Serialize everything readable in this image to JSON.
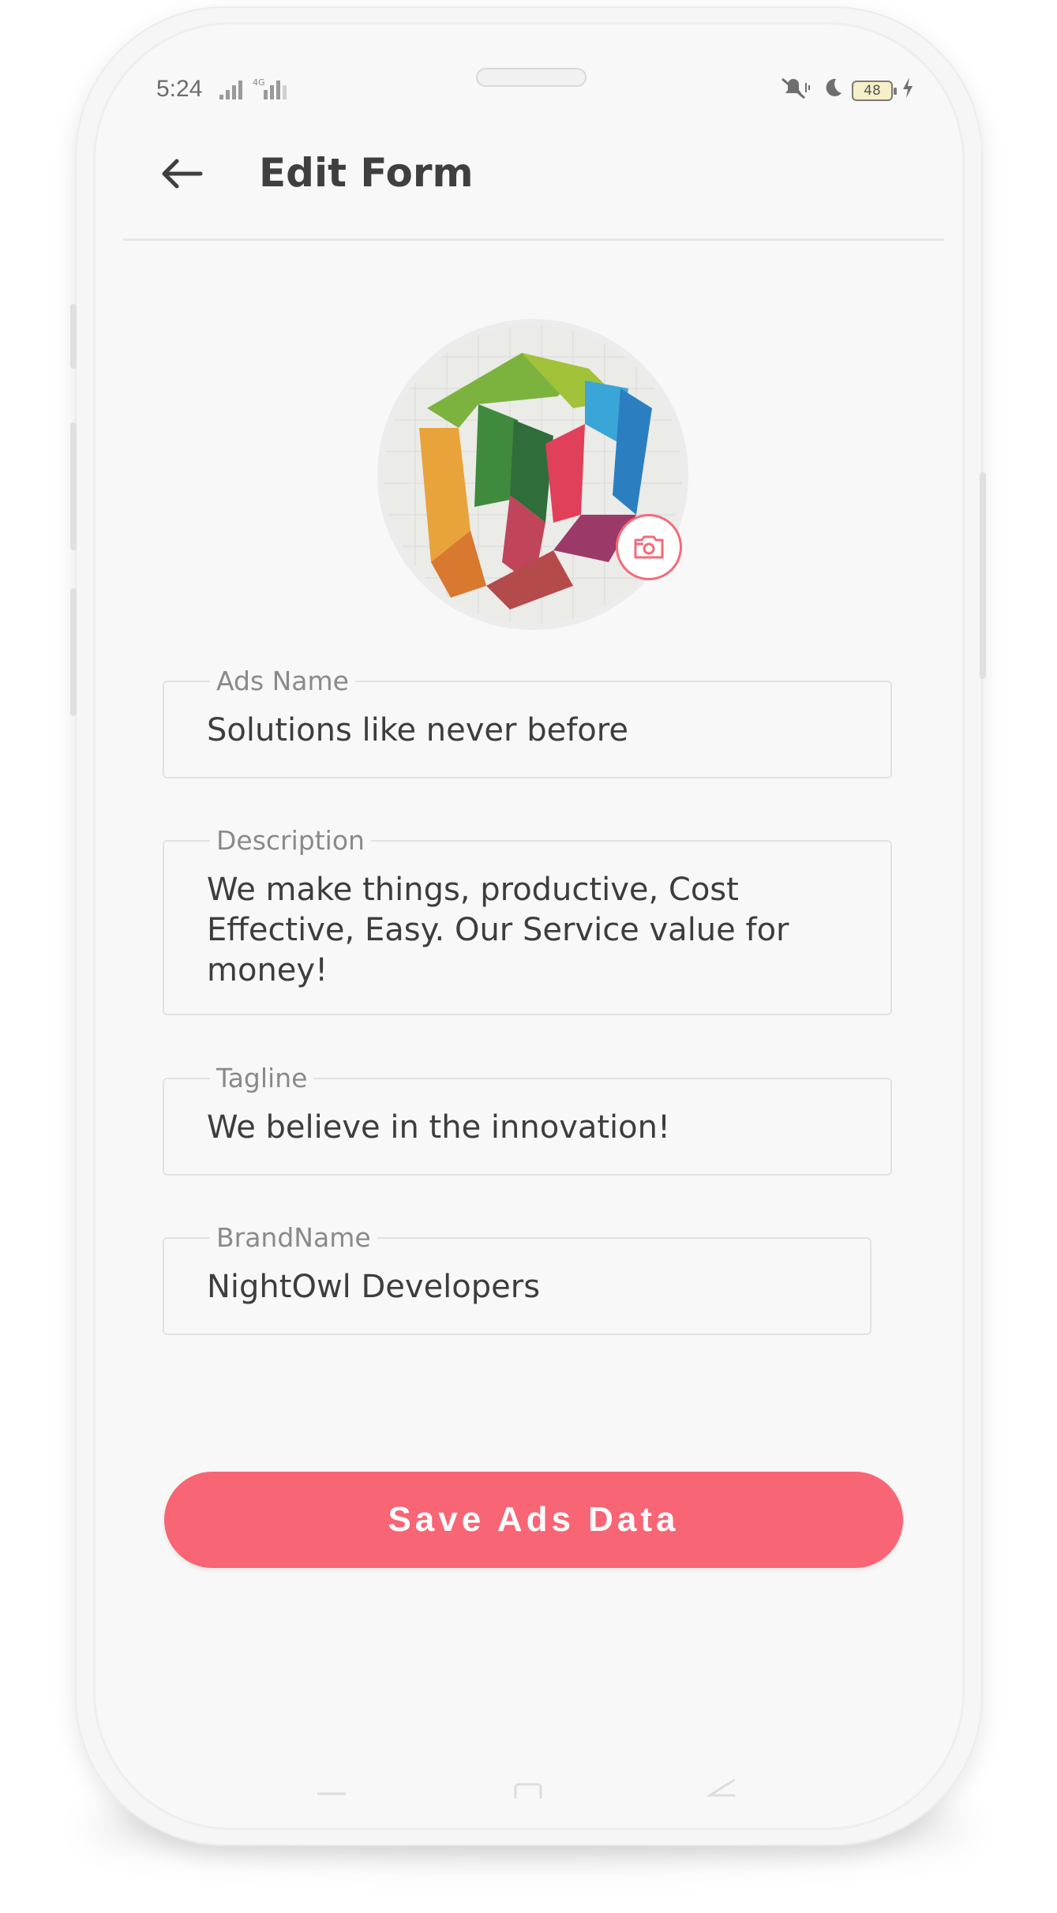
{
  "status_bar": {
    "time": "5:24",
    "network": "4G",
    "battery": "48"
  },
  "app_bar": {
    "title": "Edit Form",
    "back_icon": "arrow-left-icon"
  },
  "form": {
    "ads_name": {
      "label": "Ads Name",
      "value": "Solutions like never before"
    },
    "description": {
      "label": "Description",
      "value": "We make things, productive, Cost Effective, Easy. Our Service value for money!"
    },
    "tagline": {
      "label": "Tagline",
      "value": "We believe in the innovation!"
    },
    "brand_name": {
      "label": "BrandName",
      "value": "NightOwl Developers"
    }
  },
  "save_button": {
    "label": "Save Ads Data"
  },
  "colors": {
    "accent": "#f86574",
    "text": "#3d3d3d",
    "label": "#8a8a8a",
    "background": "#f8f8f8"
  },
  "icons": {
    "camera": "camera-icon",
    "avatar_logo": "nightowl-logo"
  }
}
